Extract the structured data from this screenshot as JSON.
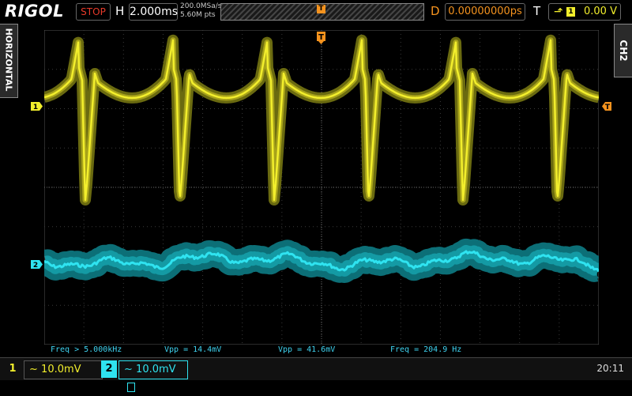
{
  "topbar": {
    "brand": "RIGOL",
    "run_state": "STOP",
    "horizontal_label": "H",
    "timebase": "2.000ms",
    "sample_rate": "200.0MSa/s",
    "memory_depth": "5.60M pts",
    "trigger_marker": "T",
    "delay_label": "D",
    "delay_value": "0.00000000ps",
    "trigger_label": "T",
    "trigger_edge": "⬏",
    "trigger_source": "1",
    "trigger_level": "0.00 V"
  },
  "side_tabs": {
    "left": "HORIZONTAL",
    "right": "CH2"
  },
  "screen_markers": {
    "trigger_pos": "T",
    "ch1_marker": "1",
    "ch2_marker": "2",
    "trigger_level_marker": "T"
  },
  "measurements": [
    {
      "label": "Freq > 5.000kHz"
    },
    {
      "label": "Vpp = 14.4mV"
    },
    {
      "label": "Vpp = 41.6mV"
    },
    {
      "label": "Freq = 204.9 Hz"
    }
  ],
  "channels": [
    {
      "number": "1",
      "coupling": "~",
      "scale": "10.0mV",
      "color": "#f2ee2c"
    },
    {
      "number": "2",
      "coupling": "~",
      "scale": "10.0mV",
      "color": "#2fe3f0"
    }
  ],
  "clock": "20:11",
  "colors": {
    "ch1": "#f2ee2c",
    "ch2": "#2fe3f0",
    "accent": "#f5931e",
    "stop": "#e83a2a"
  }
}
